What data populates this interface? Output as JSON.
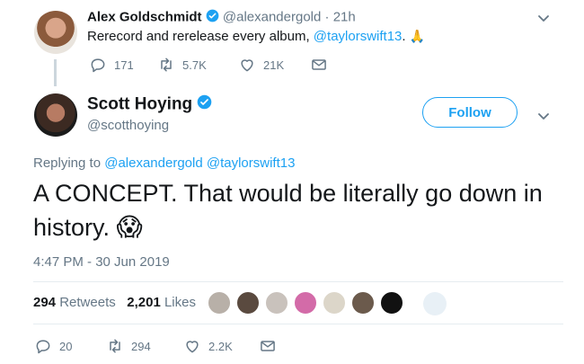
{
  "reply_tweet": {
    "display_name": "Alex Goldschmidt",
    "handle": "@alexandergold",
    "time_sep": "·",
    "time": "21h",
    "text_prefix": "Rerecord and rerelease every album,",
    "mention": "@taylorswift13",
    "text_suffix": ".",
    "emoji": "🙏",
    "replies": "171",
    "retweets": "5.7K",
    "likes": "21K"
  },
  "main_tweet": {
    "display_name": "Scott Hoying",
    "handle": "@scotthoying",
    "follow_label": "Follow",
    "replying_to_label": "Replying to",
    "replying_mentions": [
      "@alexandergold",
      "@taylorswift13"
    ],
    "text": "A CONCEPT. That would be literally go down in history.",
    "emoji": "😱",
    "timestamp": "4:47 PM - 30 Jun 2019",
    "retweets_count": "294",
    "retweets_label": "Retweets",
    "likes_count": "2,201",
    "likes_label": "Likes",
    "replies": "20",
    "retweets": "294",
    "likes": "2.2K"
  },
  "colors": {
    "accent": "#1da1f2",
    "text": "#14171a",
    "muted": "#657786",
    "thread_line": "#ccd6dd"
  }
}
